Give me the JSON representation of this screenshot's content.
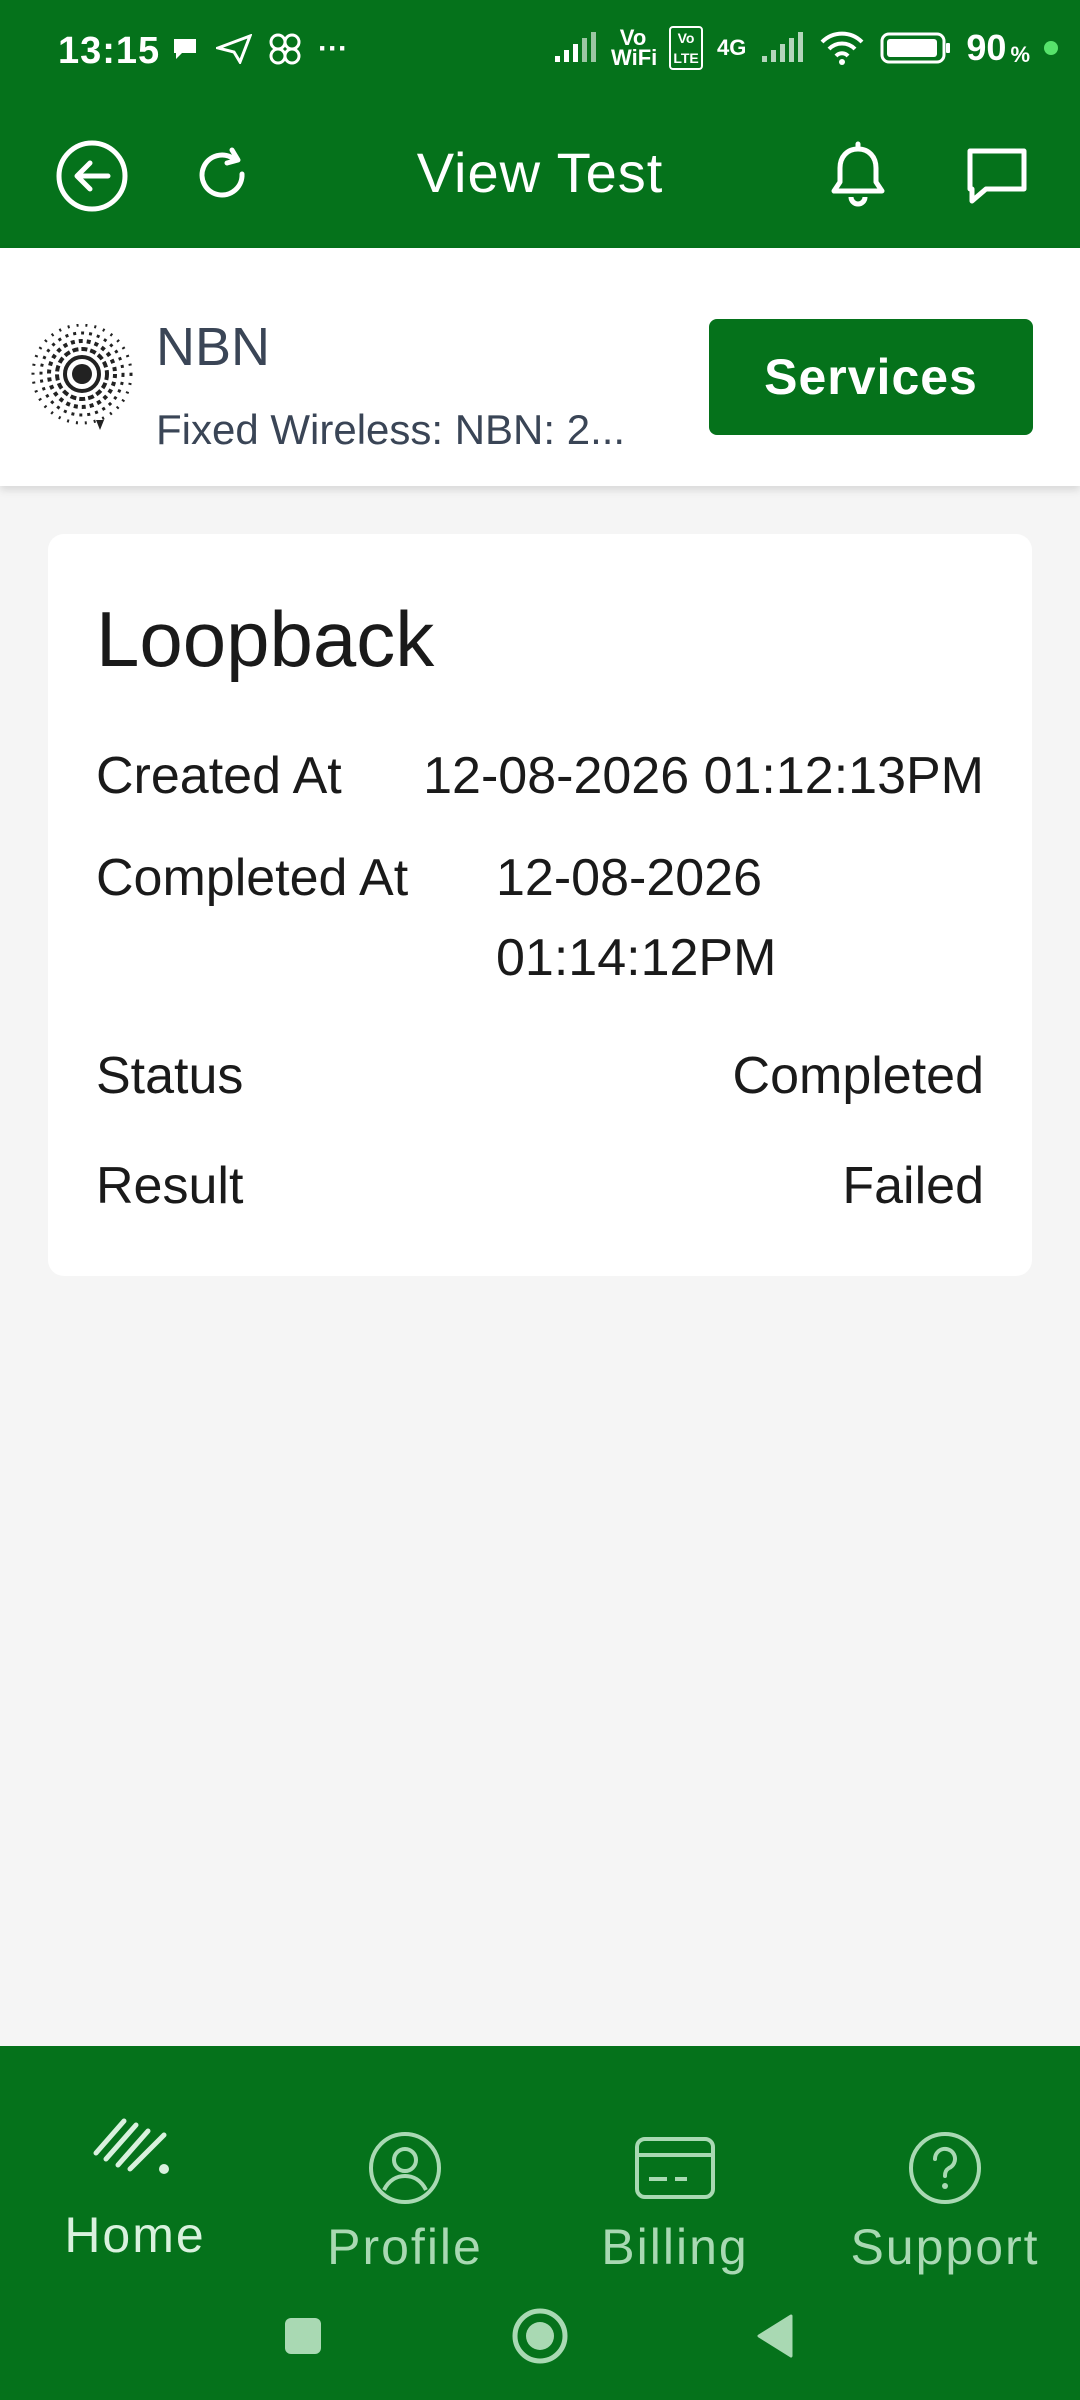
{
  "status_bar": {
    "time": "13:15",
    "vowifi": "Vo WiFi",
    "volte": "Vo LTE",
    "network": "4G",
    "battery": "90",
    "battery_unit": "%"
  },
  "app_bar": {
    "title": "View Test",
    "back_icon": "back-arrow-circle-icon",
    "refresh_icon": "refresh-icon",
    "notifications_icon": "bell-icon",
    "messages_icon": "chat-icon"
  },
  "service": {
    "name": "NBN",
    "plan": "Fixed Wireless: NBN: 2...",
    "services_label": "Services"
  },
  "test": {
    "title": "Loopback",
    "created_label": "Created At",
    "created_value": "12-08-2026 01:12:13PM",
    "completed_label": "Completed At",
    "completed_value": "12-08-2026 01:14:12PM",
    "status_label": "Status",
    "status_value": "Completed",
    "result_label": "Result",
    "result_value": "Failed"
  },
  "bottom_nav": {
    "items": [
      {
        "label": "Home",
        "icon": "wifi-signal-icon"
      },
      {
        "label": "Profile",
        "icon": "user-circle-icon"
      },
      {
        "label": "Billing",
        "icon": "credit-card-icon"
      },
      {
        "label": "Support",
        "icon": "question-circle-icon"
      }
    ]
  },
  "colors": {
    "brand_green": "#05721b",
    "background": "#f5f5f5",
    "card": "#ffffff"
  }
}
